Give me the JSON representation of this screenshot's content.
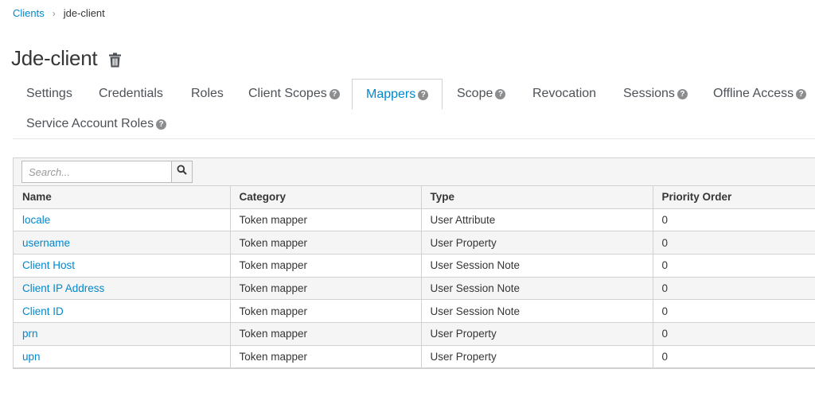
{
  "breadcrumb": {
    "parent": "Clients",
    "separator": "›",
    "current": "jde-client"
  },
  "page": {
    "title": "Jde-client",
    "delete_icon": "trash-icon"
  },
  "tabs": [
    {
      "label": "Settings",
      "help": false,
      "active": false
    },
    {
      "label": "Credentials",
      "help": false,
      "active": false
    },
    {
      "label": "Roles",
      "help": false,
      "active": false
    },
    {
      "label": "Client Scopes",
      "help": true,
      "active": false
    },
    {
      "label": "Mappers",
      "help": true,
      "active": true
    },
    {
      "label": "Scope",
      "help": true,
      "active": false
    },
    {
      "label": "Revocation",
      "help": false,
      "active": false
    },
    {
      "label": "Sessions",
      "help": true,
      "active": false
    },
    {
      "label": "Offline Access",
      "help": true,
      "active": false
    },
    {
      "label": "Service Account Roles",
      "help": true,
      "active": false
    }
  ],
  "search": {
    "placeholder": "Search...",
    "value": "",
    "button_icon": "search-icon"
  },
  "table": {
    "columns": [
      "Name",
      "Category",
      "Type",
      "Priority Order"
    ],
    "rows": [
      {
        "name": "locale",
        "category": "Token mapper",
        "type": "User Attribute",
        "priority": "0"
      },
      {
        "name": "username",
        "category": "Token mapper",
        "type": "User Property",
        "priority": "0"
      },
      {
        "name": "Client Host",
        "category": "Token mapper",
        "type": "User Session Note",
        "priority": "0"
      },
      {
        "name": "Client IP Address",
        "category": "Token mapper",
        "type": "User Session Note",
        "priority": "0"
      },
      {
        "name": "Client ID",
        "category": "Token mapper",
        "type": "User Session Note",
        "priority": "0"
      },
      {
        "name": "prn",
        "category": "Token mapper",
        "type": "User Property",
        "priority": "0"
      },
      {
        "name": "upn",
        "category": "Token mapper",
        "type": "User Property",
        "priority": "0"
      }
    ]
  },
  "colors": {
    "link": "#0088ce",
    "text": "#363636",
    "border": "#d1d1d1",
    "header_bg": "#f5f5f5"
  }
}
